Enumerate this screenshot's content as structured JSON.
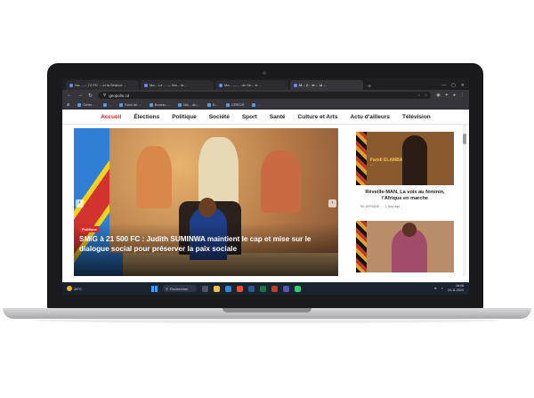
{
  "browser": {
    "tabs": [
      {
        "label": "Na... — 72 PD ... et la Séance ..."
      },
      {
        "label": "Ma... Le ... — Ma... la ..."
      },
      {
        "label": "Ma... — ... du Se... le ..."
      },
      {
        "label": "M... 2... le ... la ..."
      }
    ],
    "url": "geopolis.cd",
    "bookmarks": [
      "Gérer...",
      "...",
      "Suivi de ... ",
      "Bureau ...",
      "Ma... du...",
      "D...",
      "CREOS",
      "..."
    ]
  },
  "site_nav": {
    "items": [
      "Accueil",
      "Élections",
      "Politique",
      "Société",
      "Sport",
      "Santé",
      "Culture et Arts",
      "Actu d'ailleurs",
      "Télévision"
    ]
  },
  "hero": {
    "category": "Politique",
    "title": "SMIG à 21 500 FC : Judith SUMINWA maintient le cap et mise sur le dialogue social pour préserver la paix sociale"
  },
  "side": {
    "card1": {
      "badge_name": "Faridi ELAMBA",
      "badge_sub": "...",
      "title": "Réveille-MAN, La voix au féminin, l'Afrique en marche",
      "meta": "IN / AFRIQUE ... - 1 hour ago"
    }
  },
  "taskbar": {
    "weather": "28°C",
    "search_placeholder": "Rechercher",
    "time": "18:08",
    "date": "24-11-2024"
  },
  "colors": {
    "accent": "#e02a2a",
    "chrome_dark": "#35353b",
    "taskbar": "#1c2330"
  }
}
